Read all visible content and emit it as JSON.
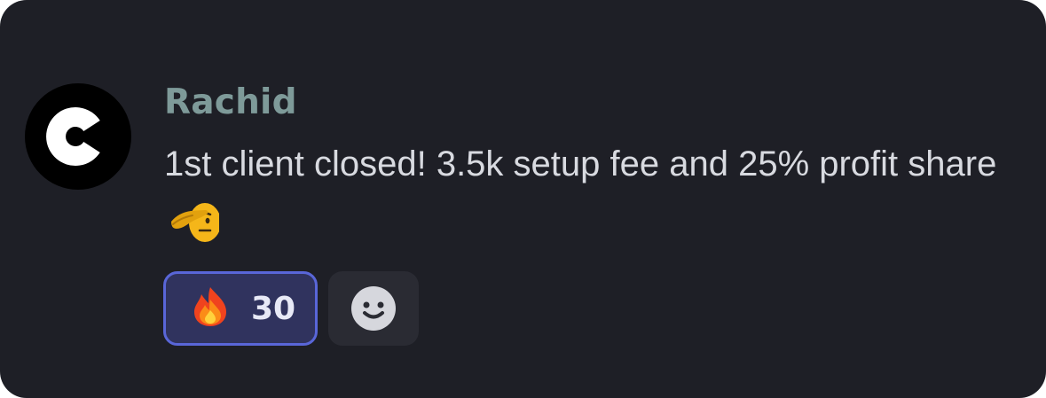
{
  "message": {
    "username": "Rachid",
    "text": "1st client closed! 3.5k setup fee and 25% profit share",
    "trailing_emoji": "saluting-face"
  },
  "avatar": {
    "icon": "letter-c-logo",
    "background": "#000000",
    "foreground": "#ffffff"
  },
  "reactions": [
    {
      "emoji": "fire",
      "count": "30",
      "selected": true
    }
  ],
  "add_reaction": {
    "icon": "smiley-face-icon"
  },
  "colors": {
    "card_background": "#1e1f26",
    "username": "#7e9a99",
    "message_text": "#d8dae0",
    "reaction_background": "#30335e",
    "reaction_border": "#5966d8",
    "add_reaction_background": "#2a2b33"
  }
}
